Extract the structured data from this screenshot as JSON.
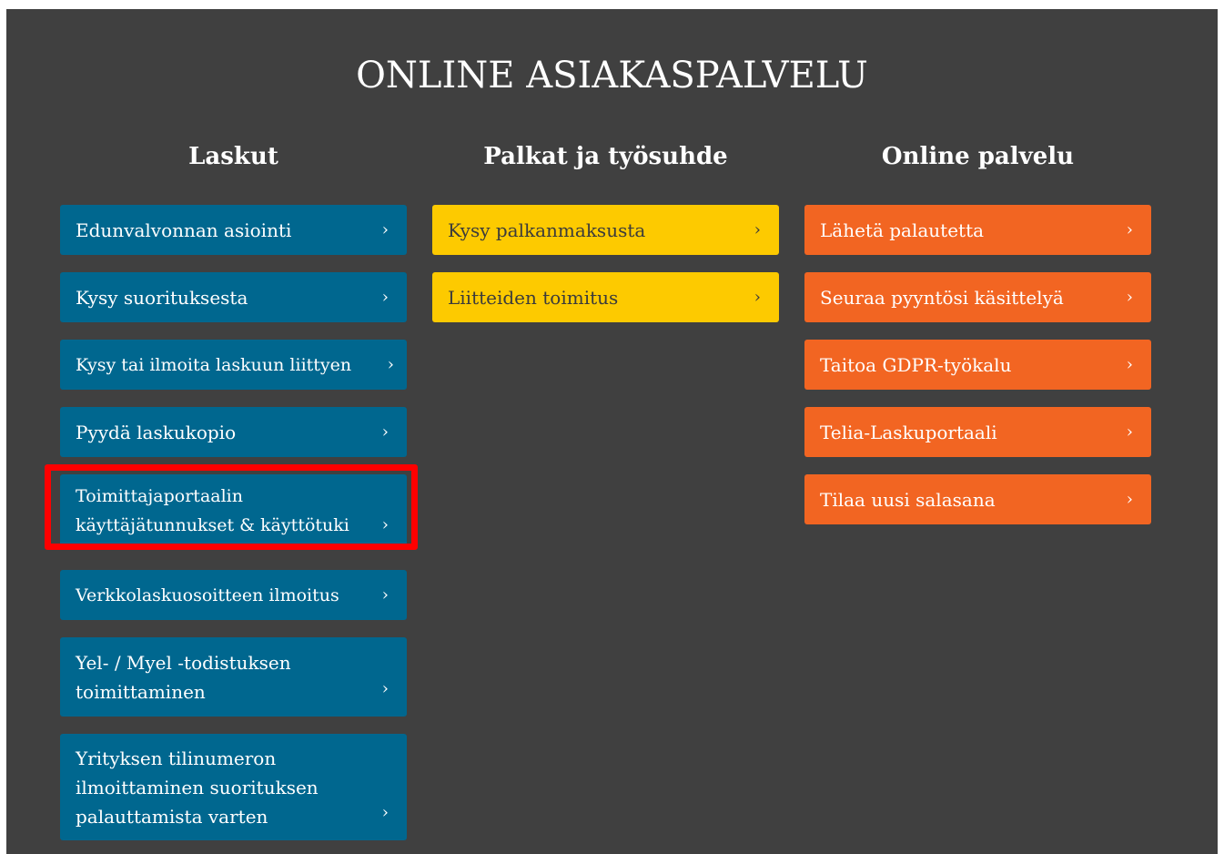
{
  "page": {
    "title": "ONLINE ASIAKASPALVELU"
  },
  "columns": [
    {
      "heading": "Laskut",
      "items": [
        {
          "label": "Edunvalvonnan asiointi"
        },
        {
          "label": "Kysy suorituksesta"
        },
        {
          "label": "Kysy tai ilmoita laskuun liittyen"
        },
        {
          "label": "Pyydä laskukopio"
        },
        {
          "label": "Toimittajaportaalin käyttäjätunnukset & käyttötuki"
        },
        {
          "label": "Verkkolaskuosoitteen ilmoitus"
        },
        {
          "label": "Yel- / Myel -todistuksen toimittaminen"
        },
        {
          "label": "Yrityksen tilinumeron ilmoittaminen suorituksen palauttamista varten"
        }
      ]
    },
    {
      "heading": "Palkat ja työsuhde",
      "items": [
        {
          "label": "Kysy palkanmaksusta"
        },
        {
          "label": "Liitteiden toimitus"
        }
      ]
    },
    {
      "heading": "Online palvelu",
      "items": [
        {
          "label": "Lähetä palautetta"
        },
        {
          "label": "Seuraa pyyntösi käsittelyä"
        },
        {
          "label": "Taitoa GDPR-työkalu"
        },
        {
          "label": "Telia-Laskuportaali"
        },
        {
          "label": "Tilaa uusi salasana"
        }
      ]
    }
  ],
  "chevron": "›",
  "colors": {
    "background": "#404040",
    "laskut": "#00678f",
    "palkat": "#fdca00",
    "online": "#f26522",
    "highlight": "#ff0000"
  }
}
